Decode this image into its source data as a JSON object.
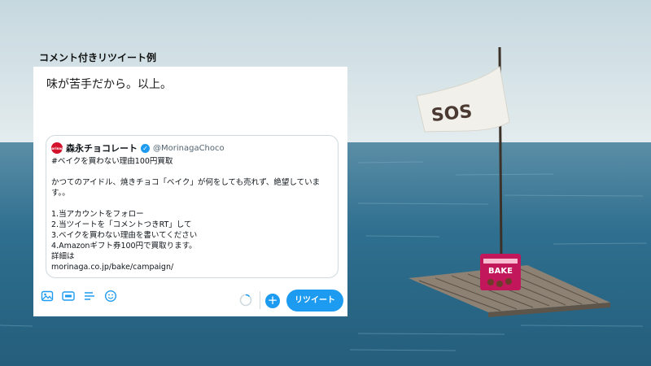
{
  "caption": "コメント付きリツイート例",
  "composer": {
    "tweet_text": "味が苦手だから。以上。",
    "toolbar": {
      "icons": [
        "image-icon",
        "gif-icon",
        "poll-icon",
        "emoji-icon"
      ],
      "add_label": "+",
      "retweet_label": "リツイート"
    }
  },
  "quote": {
    "avatar_text": "morinaga",
    "name": "森永チョコレート",
    "verified": "✓",
    "handle": "@MorinagaChoco",
    "lines": [
      "#ベイクを買わない理由100円買取",
      "",
      "かつてのアイドル、焼きチョコ「ベイク」が何をしても売れず、絶望していま",
      "す。。",
      "",
      "1.当アカウントをフォロー",
      "2.当ツイートを「コメントつきRT」して",
      "3.ベイクを買わない理由を書いてください",
      "4.Amazonギフト券100円で買取ります。",
      "詳細は",
      "morinaga.co.jp/bake/campaign/"
    ]
  },
  "scene": {
    "flag_text": "SOS",
    "product_label": "BAKE",
    "colors": {
      "sky": "#cfdde3",
      "sea": "#2f6f8f",
      "accent": "#1d9bf0",
      "package": "#c2185b"
    }
  }
}
